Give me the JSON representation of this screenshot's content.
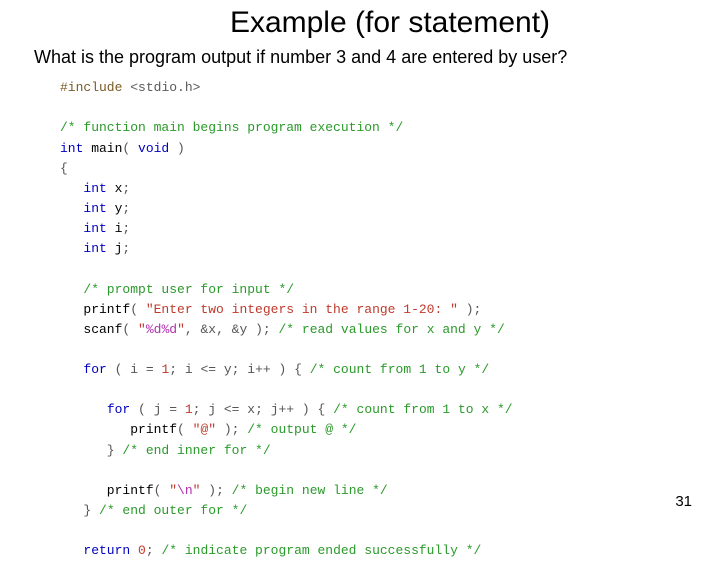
{
  "title": "Example (for statement)",
  "question": "What is the program output if number 3 and 4 are entered by user?",
  "page_number": "31",
  "code": {
    "include_directive": "#include",
    "include_lib": "<stdio.h>",
    "cm_main": "/* function main begins program execution */",
    "kw_int": "int",
    "fn_main": " main",
    "paren_open": "( ",
    "kw_void": "void",
    "paren_close": " )",
    "brace_open": "{",
    "decl_x": " x",
    "decl_y": " y",
    "decl_i": " i",
    "decl_j": " j",
    "semi": ";",
    "cm_prompt": "/* prompt user for input */",
    "printf": "   printf",
    "str_prompt": "\"Enter two integers in the range 1-20: \"",
    "close_call": " );",
    "scanf": "   scanf",
    "str_fmt_open": "\"",
    "esc_d1": "%d%d",
    "str_fmt_close": "\"",
    "scanf_args": ", &x, &y );",
    "cm_scan": " /* read values for x and y */",
    "kw_for": "for",
    "for_i_init": " ( i ",
    "eq": "= ",
    "one": "1",
    "for_i_cond": "; i ",
    "le": "<=",
    "for_i_y": " y; i",
    "inc": "++",
    "for_i_end": " ) { ",
    "cm_for_i": "/* count from 1 to y */",
    "for_j_init": " ( j ",
    "for_j_cond": "; j ",
    "for_j_x": " x; j",
    "for_j_end": " ) { ",
    "cm_for_j": "/* count from 1 to x */",
    "printf_inner": "         printf",
    "str_at": "\"@\"",
    "cm_at": " /* output @ */",
    "brace_close_inner": "      } ",
    "cm_end_inner": "/* end inner for */",
    "printf_nl": "      printf",
    "str_nl_open": "\"",
    "esc_nl": "\\n",
    "str_nl_close": "\"",
    "cm_nl": " /* begin new line */",
    "brace_close_outer": "   } ",
    "cm_end_outer": "/* end outer for */",
    "kw_return": "return",
    "zero": " 0",
    "cm_return": " /* indicate program ended successfully */"
  }
}
